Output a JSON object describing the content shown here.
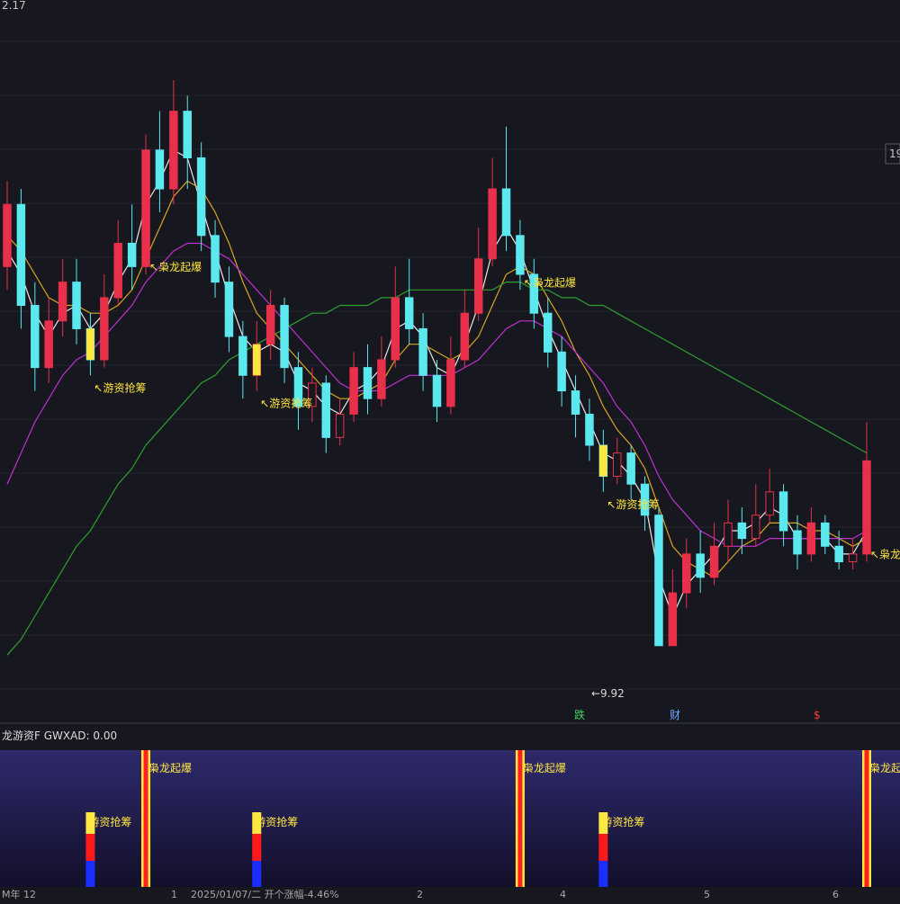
{
  "app": {
    "price_top_label": "2.17",
    "price_right_label": "19",
    "low_label": "←9.92",
    "event_tags": [
      {
        "text": "跌",
        "color": "#3cd45c"
      },
      {
        "text": "财",
        "color": "#6fa8ff"
      },
      {
        "text": "$",
        "color": "#ff3b3b"
      }
    ],
    "indicator_header": "龙游资F GWXAD: 0.00",
    "bottom_bar": {
      "left_text": "M年 12",
      "date_text": "2025/01/07/二  开个涨幅-4.46%",
      "month_ticks": [
        "1",
        "2",
        "3",
        "4",
        "5",
        "6"
      ]
    }
  },
  "colors": {
    "background": "#16171f",
    "up": "#e8304a",
    "down": "#5ce8ef",
    "ma_white": "#e8e8e8",
    "ma_yellow": "#d9a520",
    "ma_purple": "#c030d0",
    "ma_green": "#2ea02e",
    "signal_text": "#ffe640",
    "indicator_bg": "#2a2560"
  },
  "chart_data": {
    "type": "candlestick",
    "y_scale_hint": "price",
    "candles": [
      {
        "o": 14.8,
        "c": 15.6,
        "h": 15.9,
        "l": 14.5
      },
      {
        "o": 15.6,
        "c": 14.3,
        "h": 15.8,
        "l": 14.0
      },
      {
        "o": 14.3,
        "c": 13.5,
        "h": 14.6,
        "l": 13.2
      },
      {
        "o": 13.5,
        "c": 14.1,
        "h": 14.4,
        "l": 13.3
      },
      {
        "o": 14.1,
        "c": 14.6,
        "h": 14.9,
        "l": 13.9
      },
      {
        "o": 14.6,
        "c": 14.0,
        "h": 14.9,
        "l": 13.8
      },
      {
        "o": 14.0,
        "c": 13.6,
        "h": 14.2,
        "l": 13.4
      },
      {
        "o": 13.6,
        "c": 14.4,
        "h": 14.7,
        "l": 13.5
      },
      {
        "o": 14.4,
        "c": 15.1,
        "h": 15.4,
        "l": 14.3
      },
      {
        "o": 15.1,
        "c": 14.8,
        "h": 15.6,
        "l": 14.5
      },
      {
        "o": 14.8,
        "c": 16.3,
        "h": 16.5,
        "l": 14.7
      },
      {
        "o": 16.3,
        "c": 15.8,
        "h": 16.8,
        "l": 15.5
      },
      {
        "o": 15.8,
        "c": 16.8,
        "h": 17.2,
        "l": 15.6
      },
      {
        "o": 16.8,
        "c": 16.2,
        "h": 17.0,
        "l": 15.8
      },
      {
        "o": 16.2,
        "c": 15.2,
        "h": 16.4,
        "l": 15.0
      },
      {
        "o": 15.2,
        "c": 14.6,
        "h": 15.4,
        "l": 14.4
      },
      {
        "o": 14.6,
        "c": 13.9,
        "h": 14.8,
        "l": 13.7
      },
      {
        "o": 13.9,
        "c": 13.4,
        "h": 14.1,
        "l": 13.1
      },
      {
        "o": 13.4,
        "c": 13.8,
        "h": 14.1,
        "l": 13.2
      },
      {
        "o": 13.8,
        "c": 14.3,
        "h": 14.5,
        "l": 13.6
      },
      {
        "o": 14.3,
        "c": 13.5,
        "h": 14.4,
        "l": 13.3
      },
      {
        "o": 13.5,
        "c": 13.0,
        "h": 13.7,
        "l": 12.7
      },
      {
        "o": 13.0,
        "c": 13.3,
        "h": 13.5,
        "l": 12.8
      },
      {
        "o": 13.3,
        "c": 12.6,
        "h": 13.4,
        "l": 12.4
      },
      {
        "o": 12.6,
        "c": 12.9,
        "h": 13.1,
        "l": 12.5
      },
      {
        "o": 12.9,
        "c": 13.5,
        "h": 13.7,
        "l": 12.8
      },
      {
        "o": 13.5,
        "c": 13.1,
        "h": 13.8,
        "l": 12.9
      },
      {
        "o": 13.1,
        "c": 13.6,
        "h": 13.9,
        "l": 13.0
      },
      {
        "o": 13.6,
        "c": 14.4,
        "h": 14.8,
        "l": 13.5
      },
      {
        "o": 14.4,
        "c": 14.0,
        "h": 14.9,
        "l": 13.8
      },
      {
        "o": 14.0,
        "c": 13.4,
        "h": 14.2,
        "l": 13.2
      },
      {
        "o": 13.4,
        "c": 13.0,
        "h": 13.6,
        "l": 12.8
      },
      {
        "o": 13.0,
        "c": 13.6,
        "h": 13.9,
        "l": 12.9
      },
      {
        "o": 13.6,
        "c": 14.2,
        "h": 14.5,
        "l": 13.5
      },
      {
        "o": 14.2,
        "c": 14.9,
        "h": 15.3,
        "l": 14.1
      },
      {
        "o": 14.9,
        "c": 15.8,
        "h": 16.2,
        "l": 14.8
      },
      {
        "o": 15.8,
        "c": 15.2,
        "h": 16.6,
        "l": 15.0
      },
      {
        "o": 15.2,
        "c": 14.7,
        "h": 15.4,
        "l": 14.5
      },
      {
        "o": 14.7,
        "c": 14.2,
        "h": 14.9,
        "l": 14.0
      },
      {
        "o": 14.2,
        "c": 13.7,
        "h": 14.4,
        "l": 13.5
      },
      {
        "o": 13.7,
        "c": 13.2,
        "h": 13.9,
        "l": 13.0
      },
      {
        "o": 13.2,
        "c": 12.9,
        "h": 13.4,
        "l": 12.6
      },
      {
        "o": 12.9,
        "c": 12.5,
        "h": 13.1,
        "l": 12.3
      },
      {
        "o": 12.5,
        "c": 12.1,
        "h": 12.7,
        "l": 11.9
      },
      {
        "o": 12.1,
        "c": 12.4,
        "h": 12.6,
        "l": 12.0
      },
      {
        "o": 12.4,
        "c": 12.0,
        "h": 12.5,
        "l": 11.8
      },
      {
        "o": 12.0,
        "c": 11.6,
        "h": 12.1,
        "l": 11.4
      },
      {
        "o": 11.6,
        "c": 9.92,
        "h": 11.7,
        "l": 9.92
      },
      {
        "o": 9.92,
        "c": 10.6,
        "h": 10.9,
        "l": 9.92
      },
      {
        "o": 10.6,
        "c": 11.1,
        "h": 11.3,
        "l": 10.4
      },
      {
        "o": 11.1,
        "c": 10.8,
        "h": 11.4,
        "l": 10.6
      },
      {
        "o": 10.8,
        "c": 11.2,
        "h": 11.5,
        "l": 10.7
      },
      {
        "o": 11.2,
        "c": 11.5,
        "h": 11.8,
        "l": 11.0
      },
      {
        "o": 11.5,
        "c": 11.3,
        "h": 11.7,
        "l": 11.1
      },
      {
        "o": 11.3,
        "c": 11.6,
        "h": 12.0,
        "l": 11.2
      },
      {
        "o": 11.6,
        "c": 11.9,
        "h": 12.2,
        "l": 11.5
      },
      {
        "o": 11.9,
        "c": 11.4,
        "h": 12.0,
        "l": 11.2
      },
      {
        "o": 11.4,
        "c": 11.1,
        "h": 11.6,
        "l": 10.9
      },
      {
        "o": 11.1,
        "c": 11.5,
        "h": 11.7,
        "l": 11.0
      },
      {
        "o": 11.5,
        "c": 11.2,
        "h": 11.6,
        "l": 11.1
      },
      {
        "o": 11.2,
        "c": 11.0,
        "h": 11.4,
        "l": 10.9
      },
      {
        "o": 11.0,
        "c": 11.1,
        "h": 11.3,
        "l": 10.9
      },
      {
        "o": 11.1,
        "c": 12.3,
        "h": 12.8,
        "l": 11.0
      }
    ],
    "ma": [
      {
        "name": "",
        "color": "#e8e8e8",
        "values": [
          15.0,
          14.7,
          14.2,
          13.9,
          14.2,
          14.3,
          14.0,
          14.2,
          14.6,
          14.9,
          15.6,
          15.9,
          16.3,
          16.2,
          15.6,
          15.0,
          14.4,
          13.9,
          13.7,
          13.8,
          13.7,
          13.3,
          13.2,
          13.0,
          12.9,
          13.2,
          13.3,
          13.5,
          14.0,
          14.1,
          13.9,
          13.5,
          13.4,
          13.8,
          14.3,
          15.0,
          15.3,
          15.0,
          14.5,
          14.0,
          13.6,
          13.2,
          12.8,
          12.4,
          12.3,
          12.1,
          11.8,
          10.8,
          10.3,
          10.7,
          10.9,
          11.1,
          11.4,
          11.4,
          11.5,
          11.7,
          11.6,
          11.3,
          11.3,
          11.3,
          11.1,
          11.1,
          11.4
        ]
      },
      {
        "name": "",
        "color": "#d9a520",
        "values": [
          15.2,
          15.0,
          14.7,
          14.4,
          14.3,
          14.3,
          14.2,
          14.2,
          14.3,
          14.5,
          14.9,
          15.3,
          15.7,
          15.9,
          15.8,
          15.5,
          15.1,
          14.6,
          14.2,
          14.0,
          13.8,
          13.6,
          13.4,
          13.2,
          13.1,
          13.1,
          13.2,
          13.3,
          13.6,
          13.8,
          13.8,
          13.7,
          13.6,
          13.7,
          13.9,
          14.3,
          14.7,
          14.8,
          14.7,
          14.4,
          14.1,
          13.7,
          13.4,
          13.0,
          12.7,
          12.5,
          12.2,
          11.7,
          11.2,
          11.0,
          10.9,
          10.8,
          11.0,
          11.2,
          11.3,
          11.5,
          11.5,
          11.5,
          11.4,
          11.4,
          11.3,
          11.2,
          11.3
        ]
      },
      {
        "name": "",
        "color": "#c030d0",
        "values": [
          12.0,
          12.4,
          12.8,
          13.1,
          13.4,
          13.6,
          13.7,
          13.9,
          14.1,
          14.3,
          14.6,
          14.8,
          15.0,
          15.1,
          15.1,
          15.0,
          14.9,
          14.7,
          14.5,
          14.3,
          14.1,
          13.9,
          13.7,
          13.5,
          13.3,
          13.2,
          13.2,
          13.2,
          13.3,
          13.4,
          13.4,
          13.4,
          13.4,
          13.5,
          13.6,
          13.8,
          14.0,
          14.1,
          14.1,
          14.0,
          13.9,
          13.7,
          13.5,
          13.3,
          13.0,
          12.8,
          12.5,
          12.1,
          11.8,
          11.6,
          11.4,
          11.3,
          11.2,
          11.2,
          11.2,
          11.3,
          11.3,
          11.3,
          11.3,
          11.3,
          11.3,
          11.3,
          11.4
        ]
      },
      {
        "name": "",
        "color": "#2ea02e",
        "values": [
          9.8,
          10.0,
          10.3,
          10.6,
          10.9,
          11.2,
          11.4,
          11.7,
          12.0,
          12.2,
          12.5,
          12.7,
          12.9,
          13.1,
          13.3,
          13.4,
          13.6,
          13.7,
          13.8,
          13.9,
          14.0,
          14.1,
          14.2,
          14.2,
          14.3,
          14.3,
          14.3,
          14.4,
          14.4,
          14.5,
          14.5,
          14.5,
          14.5,
          14.5,
          14.5,
          14.5,
          14.6,
          14.6,
          14.5,
          14.5,
          14.4,
          14.4,
          14.3,
          14.3,
          14.2,
          14.1,
          14.0,
          13.9,
          13.8,
          13.7,
          13.6,
          13.5,
          13.4,
          13.3,
          13.2,
          13.1,
          13.0,
          12.9,
          12.8,
          12.7,
          12.6,
          12.5,
          12.4
        ]
      }
    ],
    "signals": [
      {
        "index": 6,
        "text": "游资抢筹"
      },
      {
        "index": 10,
        "text": "枭龙起爆"
      },
      {
        "index": 18,
        "text": "游资抢筹"
      },
      {
        "index": 37,
        "text": "枭龙起爆"
      },
      {
        "index": 43,
        "text": "游资抢筹"
      },
      {
        "index": 62,
        "text": "枭龙起"
      }
    ],
    "indicator": {
      "series_name": "GWXAD",
      "value": "0.00",
      "bars": [
        {
          "index": 6,
          "kind": "游资抢筹"
        },
        {
          "index": 10,
          "kind": "枭龙起爆"
        },
        {
          "index": 18,
          "kind": "游资抢筹"
        },
        {
          "index": 37,
          "kind": "枭龙起爆"
        },
        {
          "index": 43,
          "kind": "游资抢筹"
        },
        {
          "index": 62,
          "kind": "枭龙起爆"
        }
      ]
    }
  }
}
